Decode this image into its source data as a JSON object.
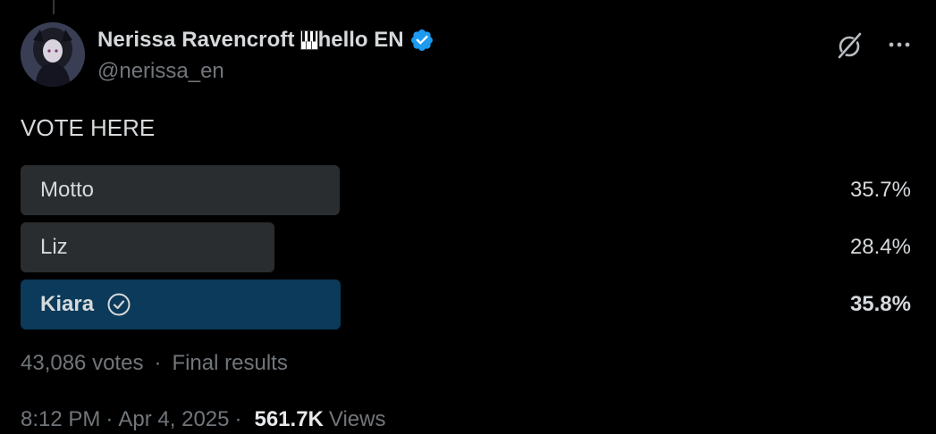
{
  "author": {
    "display_name": "Nerissa Ravencroft",
    "name_suffix": "hello EN",
    "handle": "@nerissa_en",
    "verified": true,
    "verified_color": "#1d9bf0"
  },
  "header_icons": [
    "grok-icon",
    "more-icon"
  ],
  "tweet": {
    "text": "VOTE HERE"
  },
  "poll": {
    "options": [
      {
        "label": "Motto",
        "percent": "35.7%",
        "fraction": 0.357,
        "winner": false
      },
      {
        "label": "Liz",
        "percent": "28.4%",
        "fraction": 0.284,
        "winner": false
      },
      {
        "label": "Kiara",
        "percent": "35.8%",
        "fraction": 0.358,
        "winner": true
      }
    ],
    "votes": "43,086 votes",
    "separator": "·",
    "status": "Final results",
    "winner_color": "#0b3a5a",
    "bar_color": "#2a2d30"
  },
  "meta": {
    "time": "8:12 PM",
    "date": "Apr 4, 2025",
    "separator": "·",
    "views_count": "561.7K",
    "views_label": "Views"
  }
}
